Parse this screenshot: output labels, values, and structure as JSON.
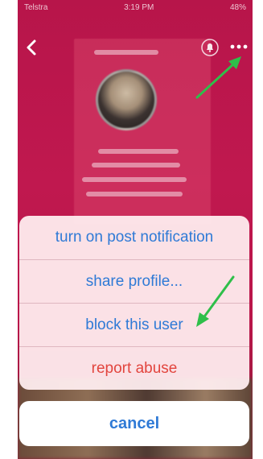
{
  "status_bar": {
    "carrier": "Telstra",
    "time": "3:19 PM",
    "battery": "48%"
  },
  "action_sheet": {
    "items": [
      {
        "label": "turn on post notification",
        "style": "default"
      },
      {
        "label": "share profile...",
        "style": "default"
      },
      {
        "label": "block this user",
        "style": "default"
      },
      {
        "label": "report abuse",
        "style": "destructive"
      }
    ],
    "cancel_label": "cancel"
  },
  "colors": {
    "accent": "#2f7ad6",
    "destructive": "#e2453e",
    "annotation_arrow": "#2fbf4a"
  },
  "icons": {
    "back": "chevron-left-icon",
    "bell": "bell-icon",
    "more": "more-horizontal-icon"
  }
}
